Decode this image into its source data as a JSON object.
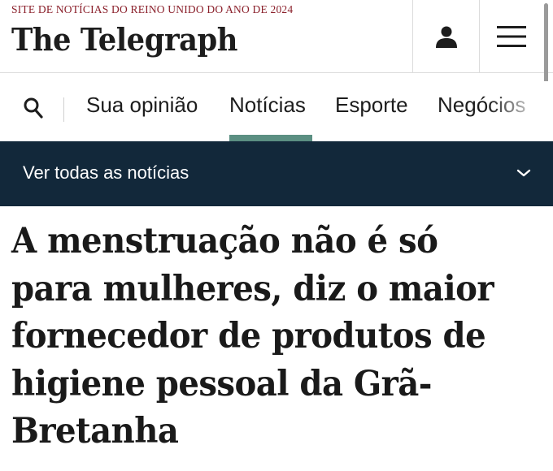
{
  "header": {
    "tagline": "SITE DE NOTÍCIAS DO REINO UNIDO DO ANO DE 2024",
    "logo": "The Telegraph",
    "account_icon": "user-icon",
    "menu_icon": "hamburger-icon"
  },
  "nav": {
    "search_icon": "search-icon",
    "items": [
      {
        "label": "Sua opinião"
      },
      {
        "label": "Notícias",
        "active": true
      },
      {
        "label": "Esporte"
      },
      {
        "label": "Negócios"
      }
    ],
    "active_color": "#5b8f82"
  },
  "subnav": {
    "label": "Ver todas as notícias",
    "chevron_icon": "chevron-down-icon",
    "background": "#12283a"
  },
  "article": {
    "headline": "A menstruação não é só para mulheres, diz o maior fornecedor de produtos de higiene pessoal da Grã-Bretanha"
  }
}
